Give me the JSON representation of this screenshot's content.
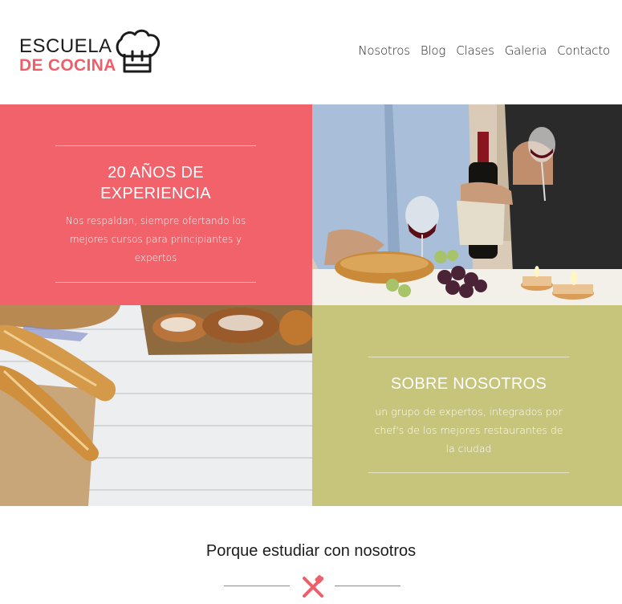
{
  "brand": {
    "line1": "ESCUELA",
    "line2": "DE COCINA",
    "accent_color": "#ef5f6a",
    "icon": "chef-hat-icon"
  },
  "nav": {
    "items": [
      "Nosotros",
      "Blog",
      "Clases",
      "Galeria",
      "Contacto"
    ]
  },
  "experience": {
    "title": "20 AÑOS DE EXPERIENCIA",
    "text": "Nos respaldan, siempre ofertando los mejores cursos para principiantes y expertos",
    "bg_color": "#f1626b"
  },
  "about": {
    "title": "SOBRE NOSOTROS",
    "text": "un grupo de expertos, integrados por chef's de los mejores restaurantes de la ciudad",
    "bg_color": "#c7c47c"
  },
  "images": {
    "wine_photo": "wine-dinner-photo",
    "bread_photo": "bread-table-photo"
  },
  "why": {
    "title": "Porque estudiar con nosotros",
    "icon": "fork-knife-icon"
  }
}
